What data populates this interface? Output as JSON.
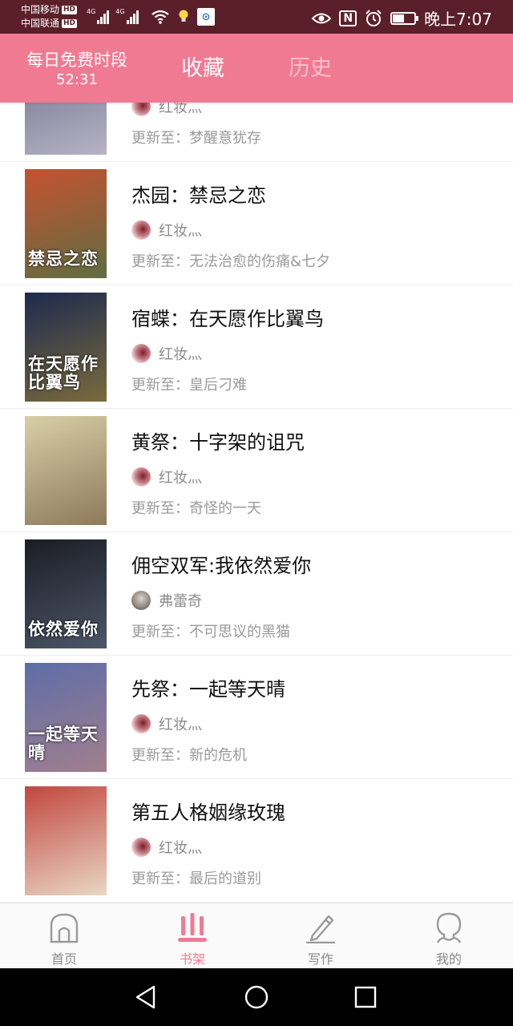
{
  "status_bar": {
    "carrier_1": "中国移动",
    "carrier_2": "中国联通",
    "hd_badge": "HD",
    "network_1": "4G",
    "network_2": "4G",
    "nfc_label": "N",
    "battery_level": 0.55,
    "time": "晚上7:07"
  },
  "header": {
    "free_period_title": "每日免费时段",
    "free_period_timer": "52:31",
    "tabs": [
      {
        "label": "收藏",
        "active": true
      },
      {
        "label": "历史",
        "active": false
      }
    ]
  },
  "update_prefix": "更新至：",
  "books": [
    {
      "title": "",
      "author": "红妆灬",
      "update": "梦醒意犹存",
      "cover_text": "",
      "cover_colors": [
        "#6a6d89",
        "#b7b3c4"
      ]
    },
    {
      "title": "杰园：禁忌之恋",
      "author": "红妆灬",
      "update": "无法治愈的伤痛&七夕",
      "cover_text": "禁忌之恋",
      "cover_colors": [
        "#c6522f",
        "#5f6d43"
      ]
    },
    {
      "title": "宿蝶：在天愿作比翼鸟",
      "author": "红妆灬",
      "update": "皇后刁难",
      "cover_text": "在天愿作比翼鸟",
      "cover_colors": [
        "#1d2a4f",
        "#7a6a3d"
      ]
    },
    {
      "title": "黄祭：十字架的诅咒",
      "author": "红妆灬",
      "update": "奇怪的一天",
      "cover_text": "",
      "cover_colors": [
        "#d8cfa7",
        "#8d7a5a"
      ]
    },
    {
      "title": "佣空双军:我依然爱你",
      "author": "弗蕾奇",
      "update": "不可思议的黑猫",
      "cover_text": "依然爱你",
      "cover_colors": [
        "#1b1d24",
        "#4c5668"
      ]
    },
    {
      "title": "先祭：一起等天晴",
      "author": "红妆灬",
      "update": "新的危机",
      "cover_text": "一起等天晴",
      "cover_colors": [
        "#5d6da8",
        "#a27f8d"
      ]
    },
    {
      "title": "第五人格姻缘玫瑰",
      "author": "红妆灬",
      "update": "最后的道别",
      "cover_text": "",
      "cover_colors": [
        "#c2463f",
        "#e9d7c4"
      ]
    }
  ],
  "bottom_nav": [
    {
      "label": "首页",
      "icon": "home-icon",
      "active": false
    },
    {
      "label": "书架",
      "icon": "bookshelf-icon",
      "active": true
    },
    {
      "label": "写作",
      "icon": "pencil-icon",
      "active": false
    },
    {
      "label": "我的",
      "icon": "profile-icon",
      "active": false
    }
  ],
  "colors": {
    "accent": "#f07a92",
    "status_bar": "#5b1f2a",
    "title_text": "#111111",
    "meta_text": "#9a9a9a"
  }
}
